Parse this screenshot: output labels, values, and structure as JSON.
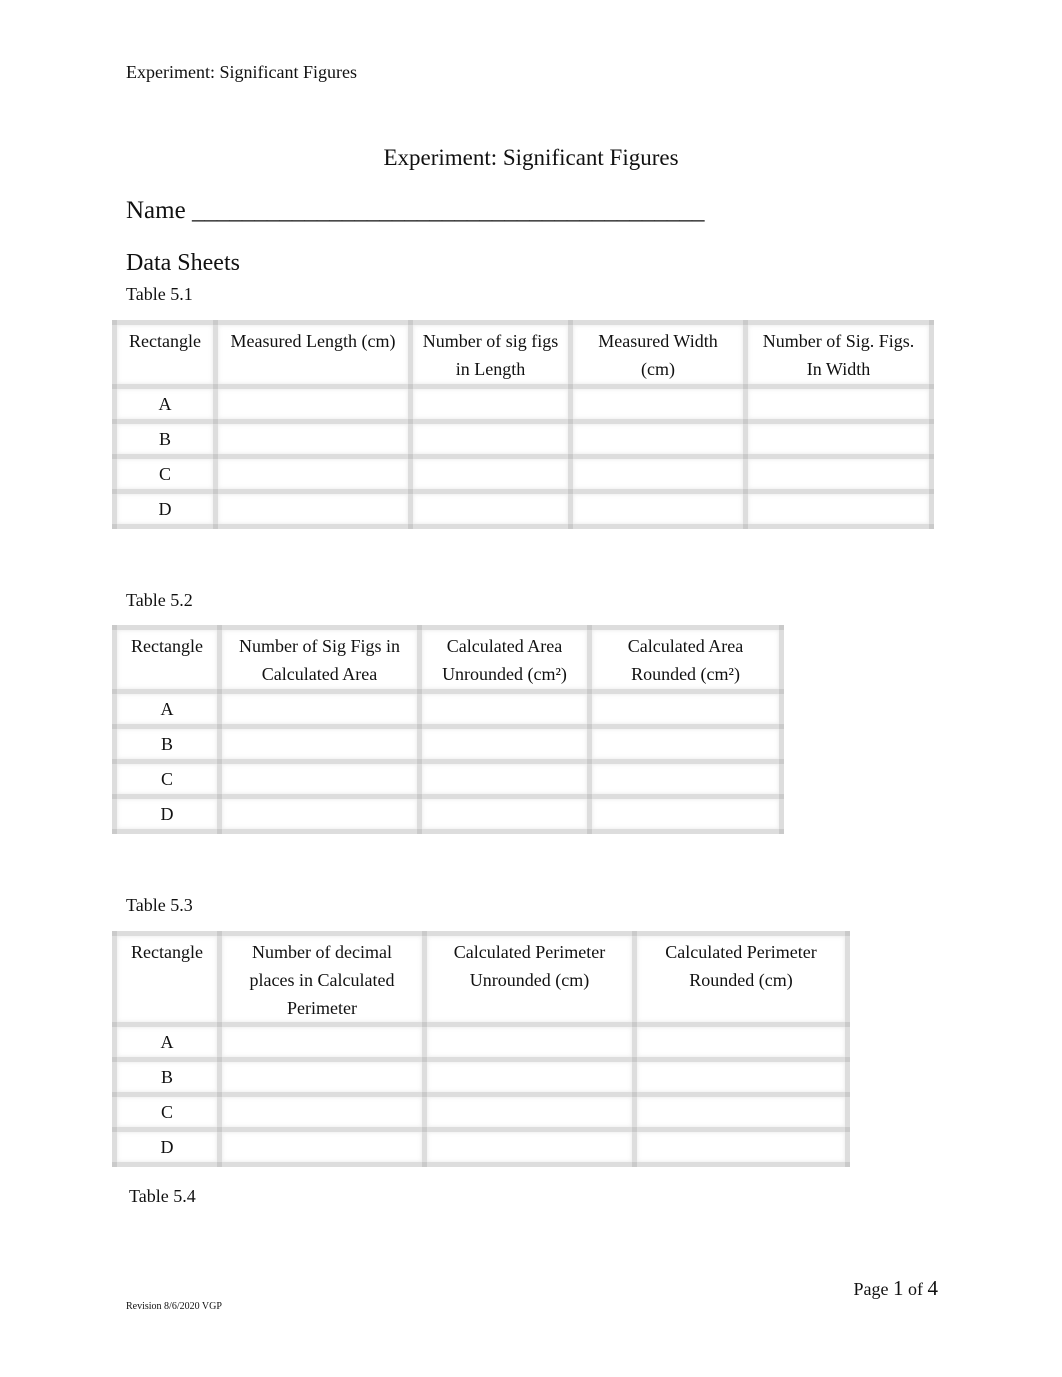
{
  "header": {
    "running_title": "Experiment: Significant Figures"
  },
  "title": "Experiment: Significant Figures",
  "name_field": {
    "label": "Name",
    "blank": "_________________________________________"
  },
  "section_title": "Data Sheets",
  "tables": [
    {
      "caption": "Table 5.1",
      "headers": [
        "Rectangle",
        "Measured Length (cm)",
        "Number of sig figs in Length",
        "Measured Width (cm)",
        "Number of Sig. Figs. In Width"
      ],
      "rows": [
        [
          "A",
          "",
          "",
          "",
          ""
        ],
        [
          "B",
          "",
          "",
          "",
          ""
        ],
        [
          "C",
          "",
          "",
          "",
          ""
        ],
        [
          "D",
          "",
          "",
          "",
          ""
        ]
      ]
    },
    {
      "caption": "Table 5.2",
      "headers": [
        "Rectangle",
        "Number of Sig Figs in Calculated Area",
        "Calculated Area Unrounded (cm²)",
        "Calculated Area Rounded (cm²)"
      ],
      "rows": [
        [
          "A",
          "",
          "",
          ""
        ],
        [
          "B",
          "",
          "",
          ""
        ],
        [
          "C",
          "",
          "",
          ""
        ],
        [
          "D",
          "",
          "",
          ""
        ]
      ]
    },
    {
      "caption": "Table 5.3",
      "headers": [
        "Rectangle",
        "Number of decimal places in Calculated Perimeter",
        "Calculated Perimeter Unrounded (cm)",
        "Calculated Perimeter Rounded (cm)"
      ],
      "rows": [
        [
          "A",
          "",
          "",
          ""
        ],
        [
          "B",
          "",
          "",
          ""
        ],
        [
          "C",
          "",
          "",
          ""
        ],
        [
          "D",
          "",
          "",
          ""
        ]
      ]
    },
    {
      "caption": "Table 5.4"
    }
  ],
  "footer": {
    "page_prefix": "Page",
    "page_current": "1",
    "page_of": "of",
    "page_total": "4",
    "revision": "Revision 8/6/2020 VGP"
  }
}
